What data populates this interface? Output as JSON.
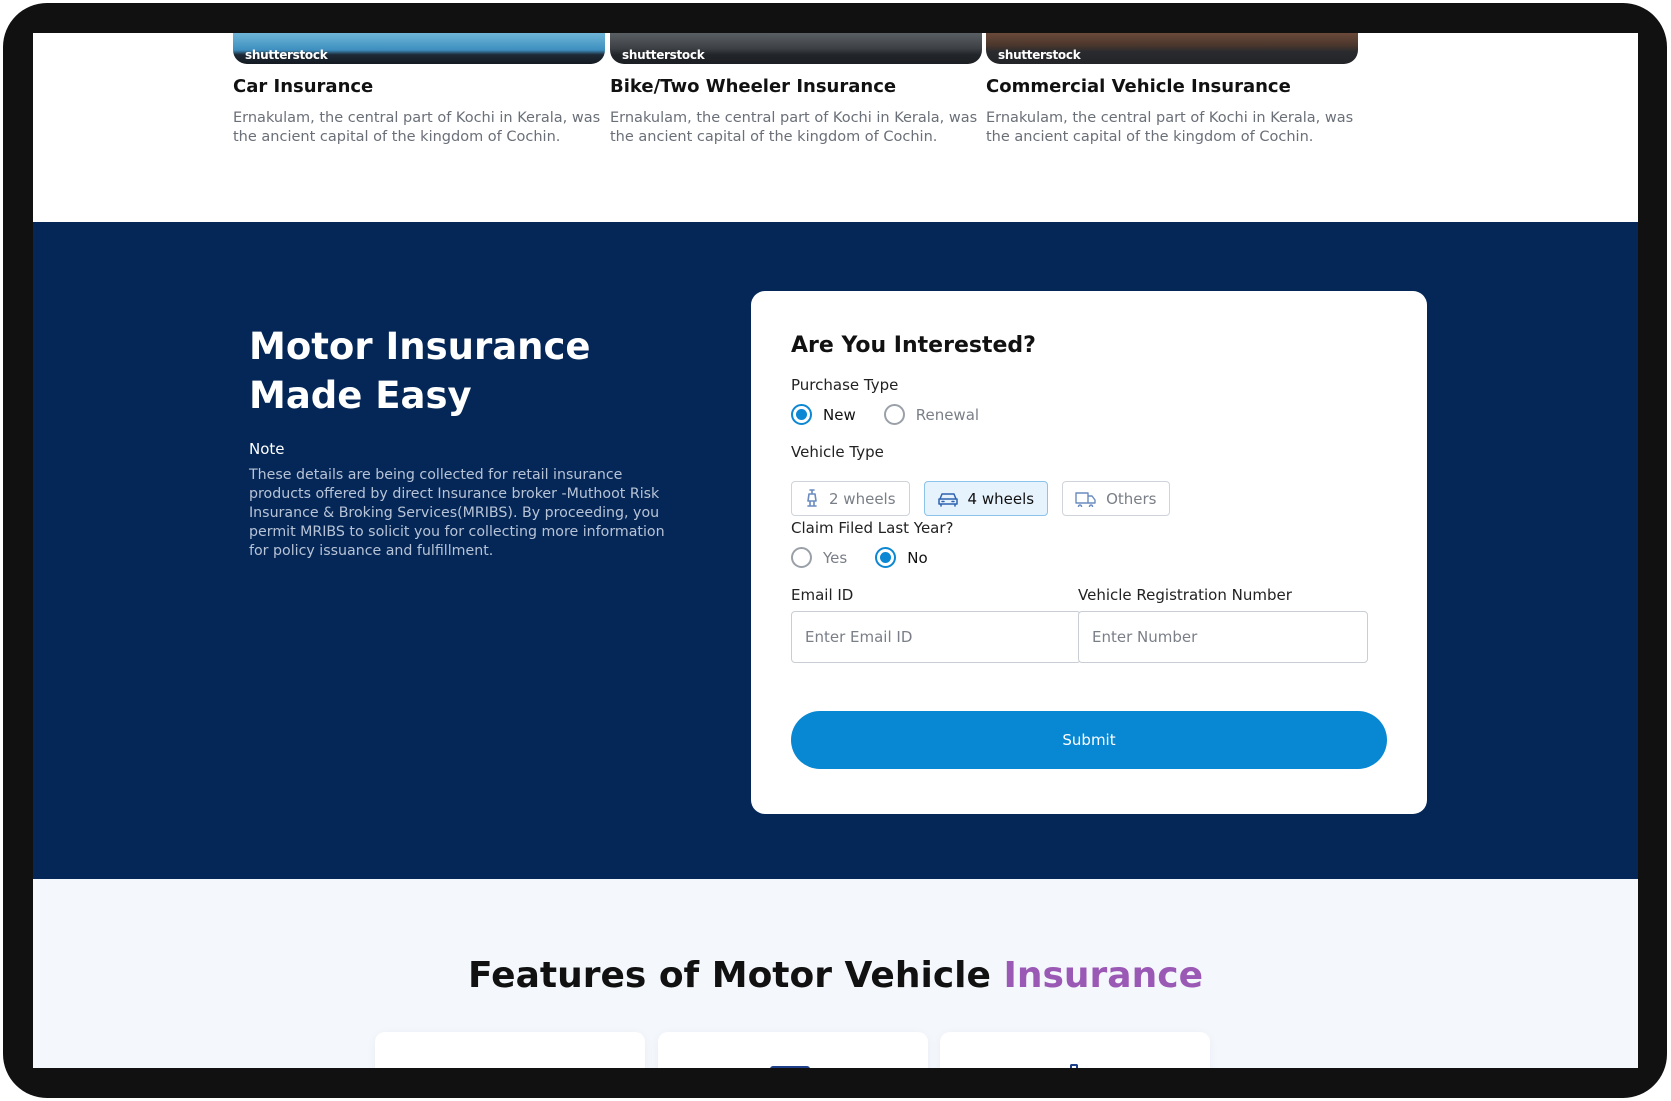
{
  "cards": [
    {
      "watermark": "shutterstock",
      "title": "Car Insurance",
      "description": "Ernakulam, the central part of Kochi in Kerala, was the ancient capital of the kingdom of Cochin."
    },
    {
      "watermark": "shutterstock",
      "title": "Bike/Two Wheeler Insurance",
      "description": "Ernakulam, the central part of Kochi in Kerala, was the ancient capital of the kingdom of Cochin."
    },
    {
      "watermark": "shutterstock",
      "title": "Commercial Vehicle Insurance",
      "description": "Ernakulam, the central part of Kochi in Kerala, was the ancient capital of the kingdom of Cochin."
    }
  ],
  "hero": {
    "title": "Motor Insurance Made Easy",
    "note_label": "Note",
    "note_text": "These details are being collected for retail insurance products offered by direct Insurance broker -Muthoot Risk Insurance & Broking Services(MRIBS). By proceeding, you permit MRIBS to solicit you for collecting more information for policy issuance and fulfillment."
  },
  "form": {
    "title": "Are You Interested?",
    "purchase_type": {
      "label": "Purchase Type",
      "options": [
        "New",
        "Renewal"
      ],
      "selected": "New"
    },
    "vehicle_type": {
      "label": "Vehicle Type",
      "options": [
        {
          "label": "2 wheels",
          "icon": "scooter-icon"
        },
        {
          "label": "4 wheels",
          "icon": "car-icon"
        },
        {
          "label": "Others",
          "icon": "truck-icon"
        }
      ],
      "selected": "4 wheels"
    },
    "claim_filed": {
      "label": "Claim Filed Last Year?",
      "options": [
        "Yes",
        "No"
      ],
      "selected": "No"
    },
    "email": {
      "label": "Email ID",
      "placeholder": "Enter Email ID",
      "value": ""
    },
    "registration": {
      "label": "Vehicle Registration Number",
      "placeholder": "Enter Number",
      "value": ""
    },
    "submit_label": "Submit"
  },
  "features": {
    "title_main": "Features of Motor Vehicle",
    "title_accent": "Insurance"
  },
  "colors": {
    "navy_background": "#052757",
    "primary_blue": "#0888d3",
    "accent_purple": "#9b59b6"
  }
}
